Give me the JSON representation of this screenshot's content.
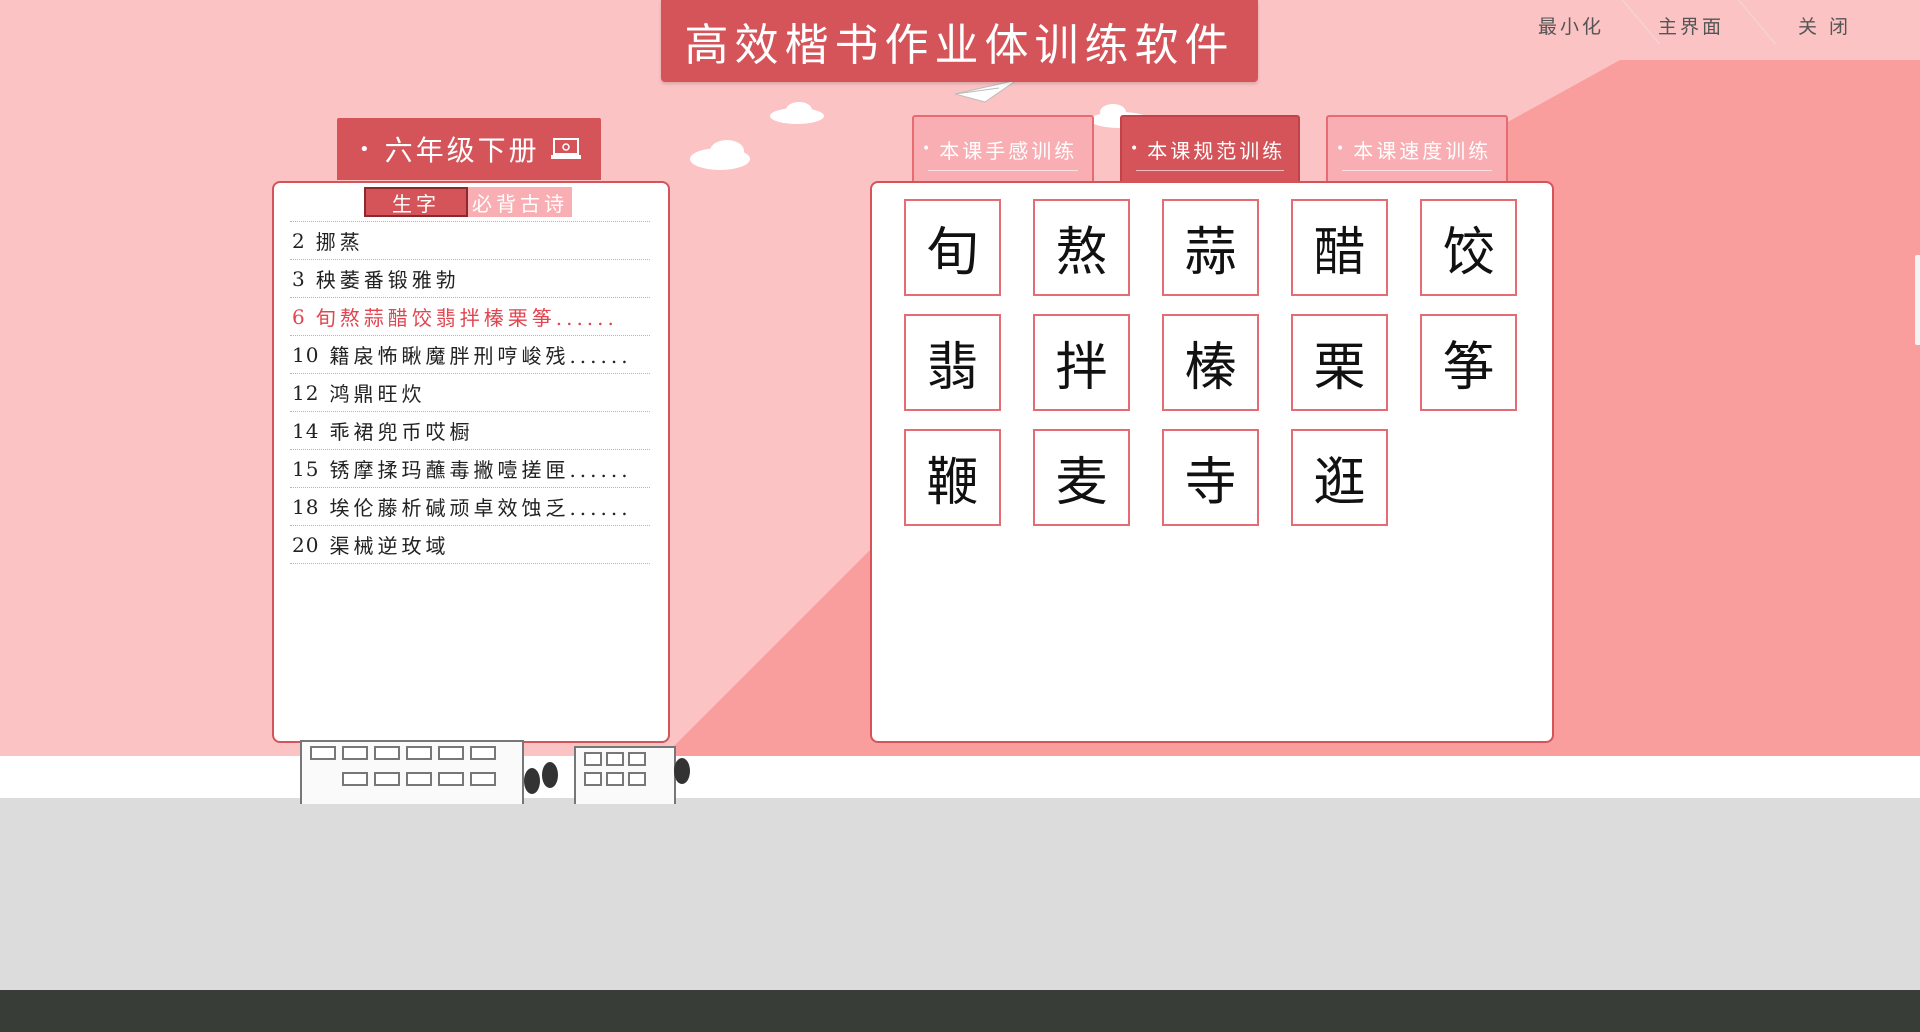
{
  "app": {
    "title": "高效楷书作业体训练软件"
  },
  "window_controls": {
    "minimize": "最小化",
    "home": "主界面",
    "close": "关 闭"
  },
  "grade": {
    "label": "六年级下册"
  },
  "subtabs": {
    "new_chars": "生字",
    "poems": "必背古诗"
  },
  "lessons": [
    {
      "num": "2",
      "chars": "挪蒸"
    },
    {
      "num": "3",
      "chars": "秧萎番锻雅勃"
    },
    {
      "num": "6",
      "chars": "旬熬蒜醋饺翡拌榛栗筝......",
      "selected": true
    },
    {
      "num": "10",
      "chars": "籍扆怖瞅魔胖刑哼峻残......"
    },
    {
      "num": "12",
      "chars": "鸿鼎旺炊"
    },
    {
      "num": "14",
      "chars": "乖裙兜币哎橱"
    },
    {
      "num": "15",
      "chars": "锈摩揉玛蘸毒撇噎搓匣......"
    },
    {
      "num": "18",
      "chars": "埃伦藤析碱顽卓效蚀乏......"
    },
    {
      "num": "20",
      "chars": "渠械逆玫域"
    }
  ],
  "modes": [
    {
      "label": "本课手感训练",
      "active": false
    },
    {
      "label": "本课规范训练",
      "active": true
    },
    {
      "label": "本课速度训练",
      "active": false
    }
  ],
  "characters": [
    "旬",
    "熬",
    "蒜",
    "醋",
    "饺",
    "翡",
    "拌",
    "榛",
    "栗",
    "筝",
    "鞭",
    "麦",
    "寺",
    "逛"
  ],
  "colors": {
    "accent": "#d4545a",
    "background": "#fcc3c4",
    "selected_text": "#e04550"
  }
}
